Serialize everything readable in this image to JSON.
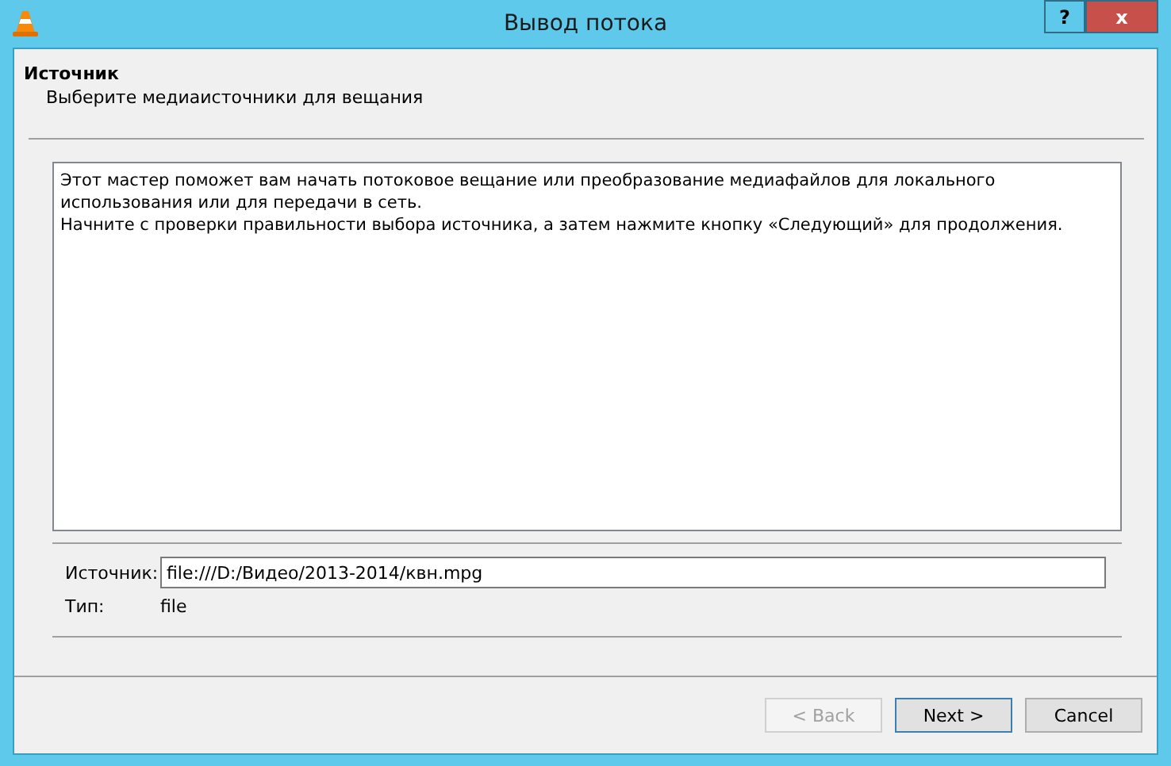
{
  "window": {
    "title": "Вывод потока",
    "help_button": "?",
    "close_button": "x"
  },
  "header": {
    "title": "Источник",
    "subtitle": "Выберите медиаисточники для вещания"
  },
  "description": [
    "Этот мастер поможет вам начать потоковое вещание или преобразование медиафайлов для локального использования или для передачи в сеть.",
    "Начните с проверки правильности выбора источника, а затем нажмите кнопку «Следующий» для продолжения."
  ],
  "source": {
    "label": "Источник:",
    "value": "file:///D:/Видео/2013-2014/квн.mpg"
  },
  "type": {
    "label": "Тип:",
    "value": "file"
  },
  "buttons": [
    {
      "label": "< Back",
      "disabled": true,
      "default": false
    },
    {
      "label": "Next >",
      "disabled": false,
      "default": true
    },
    {
      "label": "Cancel",
      "disabled": false,
      "default": false
    }
  ]
}
